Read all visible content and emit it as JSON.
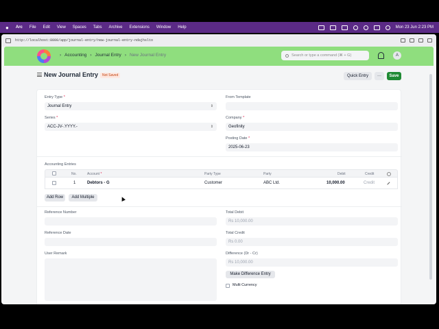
{
  "menubar": {
    "app": "Arc",
    "items": [
      "File",
      "Edit",
      "View",
      "Spaces",
      "Tabs",
      "Archive",
      "Extensions",
      "Window",
      "Help"
    ],
    "datetime": "Mon 23 Jun  2:23 PM"
  },
  "browser": {
    "url": "http://localhost:8000/app/journal-entry/new-journal-entry-ndajhslto"
  },
  "nav": {
    "breadcrumbs": [
      "Accounting",
      "Journal Entry",
      "New Journal Entry"
    ],
    "search_placeholder": "Search or type a command (⌘ + G)",
    "avatar_initial": "A"
  },
  "page": {
    "title": "New Journal Entry",
    "status": "Not Saved",
    "quick_entry": "Quick Entry",
    "more": "···",
    "save": "Save"
  },
  "form": {
    "entry_type": {
      "label": "Entry Type",
      "value": "Journal Entry"
    },
    "series": {
      "label": "Series",
      "value": "ACC-JV-.YYYY.-"
    },
    "from_template": {
      "label": "From Template",
      "value": ""
    },
    "company": {
      "label": "Company",
      "value": "Geofinity"
    },
    "posting_date": {
      "label": "Posting Date",
      "value": "2025-06-23"
    },
    "accounting_entries_label": "Accounting Entries",
    "reference_number": {
      "label": "Reference Number",
      "value": ""
    },
    "reference_date": {
      "label": "Reference Date",
      "value": ""
    },
    "user_remark": {
      "label": "User Remark",
      "value": ""
    },
    "total_debit": {
      "label": "Total Debit",
      "value": "Rs 10,000.00"
    },
    "total_credit": {
      "label": "Total Credit",
      "value": "Rs 0.00"
    },
    "difference": {
      "label": "Difference (Dr - Cr)",
      "value": "Rs 10,000.00"
    },
    "make_difference_entry": "Make Difference Entry",
    "multi_currency": "Multi Currency"
  },
  "table": {
    "headers": {
      "no": "No.",
      "account": "Account",
      "party_type": "Party Type",
      "party": "Party",
      "debit": "Debit",
      "credit": "Credit"
    },
    "rows": [
      {
        "no": "1",
        "account": "Debtors - G",
        "party_type": "Customer",
        "party": "ABC Ltd.",
        "debit": "10,000.00",
        "credit": "Credit"
      }
    ],
    "add_row": "Add Row",
    "add_multiple": "Add Multiple"
  }
}
